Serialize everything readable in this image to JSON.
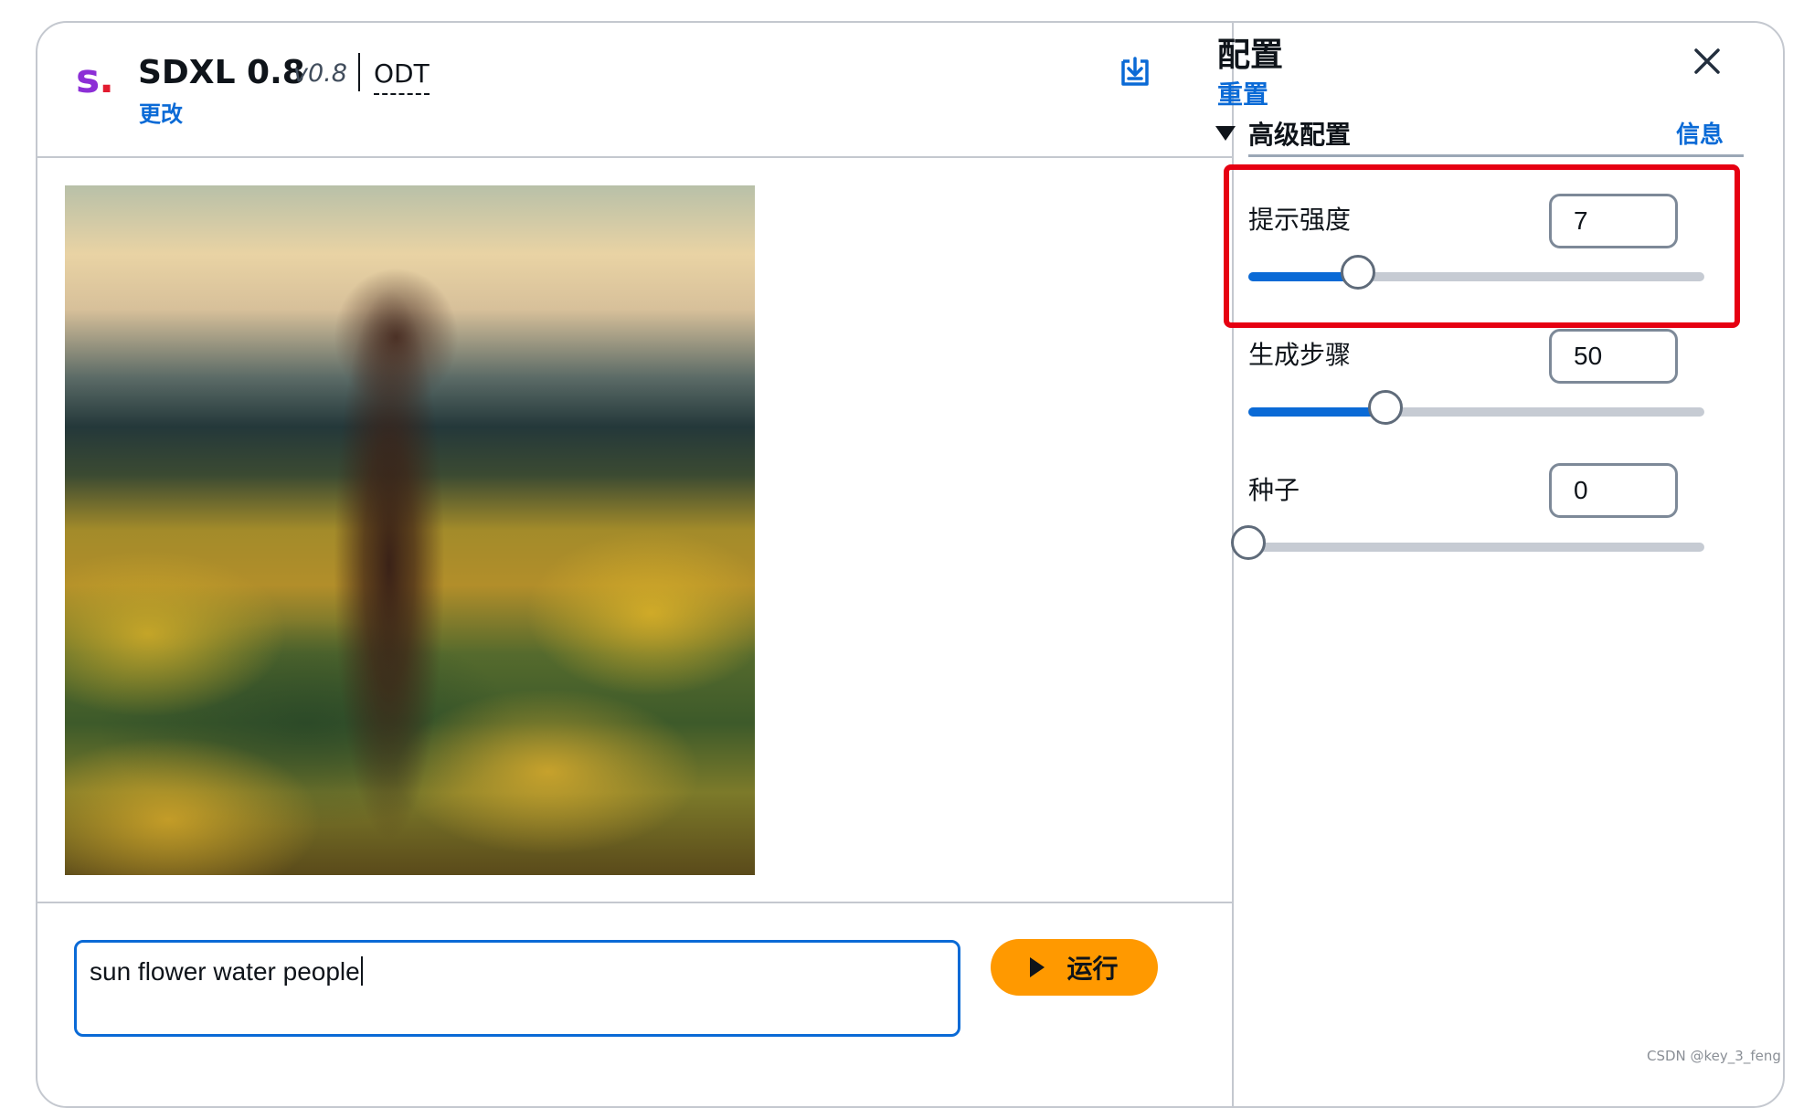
{
  "header": {
    "logo_letter": "s",
    "logo_dot": ".",
    "title": "SDXL 0.8",
    "version": "v0.8",
    "tag": "ODT",
    "change_link": "更改"
  },
  "prompt": {
    "value": "sun flower water people",
    "run_label": "运行"
  },
  "config": {
    "title": "配置",
    "reset_label": "重置",
    "advanced": {
      "title": "高级配置",
      "info_link": "信息"
    },
    "params": [
      {
        "label": "提示强度",
        "value": "7",
        "slider_fraction": 0.24
      },
      {
        "label": "生成步骤",
        "value": "50",
        "slider_fraction": 0.3
      },
      {
        "label": "种子",
        "value": "0",
        "slider_fraction": 0.0
      }
    ]
  },
  "icons": {
    "download": "download-icon",
    "close": "close-icon",
    "play": "play-icon"
  },
  "colors": {
    "accent": "#0a6ad6",
    "run_button": "#ff9900",
    "highlight": "#e60012",
    "logo_s": "#8c2fd6",
    "logo_dot": "#e21b2f"
  },
  "watermark": "CSDN @key_3_feng"
}
